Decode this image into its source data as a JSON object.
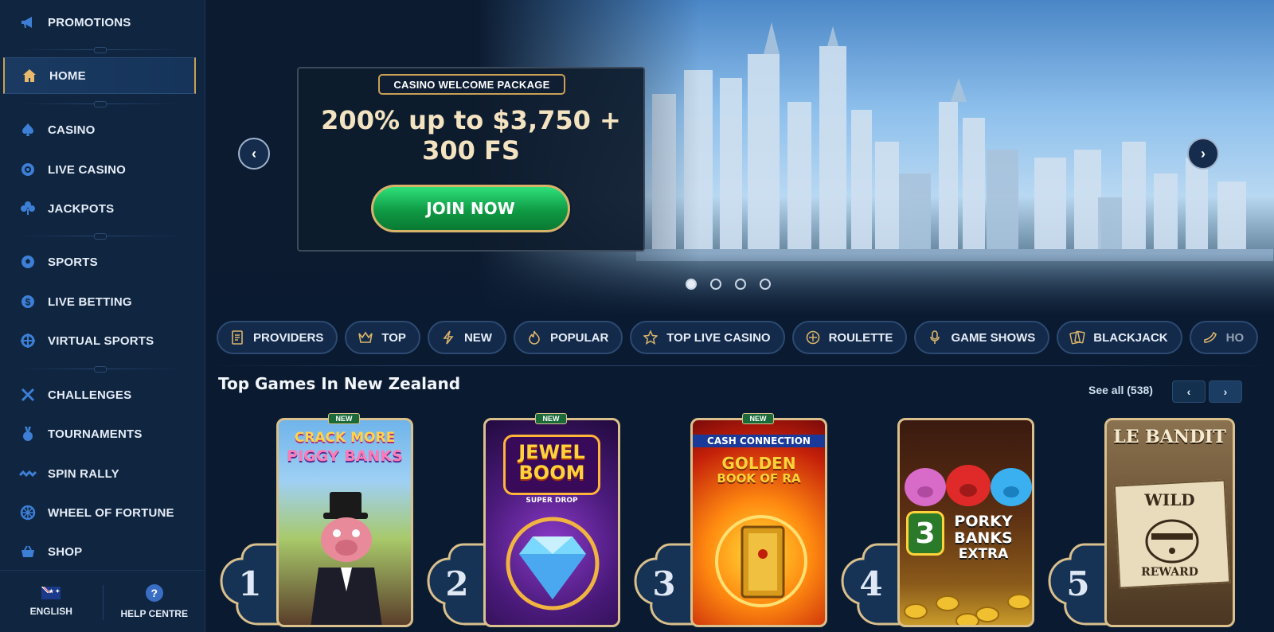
{
  "sidebar": {
    "items": [
      {
        "label": "PROMOTIONS",
        "icon": "megaphone-icon"
      },
      {
        "label": "HOME",
        "icon": "home-icon",
        "active": true
      },
      {
        "label": "CASINO",
        "icon": "spade-icon"
      },
      {
        "label": "LIVE CASINO",
        "icon": "chip-icon"
      },
      {
        "label": "JACKPOTS",
        "icon": "clover-icon"
      },
      {
        "label": "SPORTS",
        "icon": "football-icon"
      },
      {
        "label": "LIVE BETTING",
        "icon": "dollar-coin-icon"
      },
      {
        "label": "VIRTUAL SPORTS",
        "icon": "target-icon"
      },
      {
        "label": "CHALLENGES",
        "icon": "crossed-swords-icon"
      },
      {
        "label": "TOURNAMENTS",
        "icon": "medal-icon"
      },
      {
        "label": "SPIN RALLY",
        "icon": "rally-icon"
      },
      {
        "label": "WHEEL OF FORTUNE",
        "icon": "wheel-icon"
      },
      {
        "label": "SHOP",
        "icon": "basket-icon"
      }
    ],
    "footer": {
      "language": "ENGLISH",
      "help": "HELP CENTRE",
      "help_glyph": "?"
    }
  },
  "hero": {
    "badge": "CASINO WELCOME PACKAGE",
    "title_line1": "200% up to $3,750 +",
    "title_line2": "300 FS",
    "cta": "JOIN NOW",
    "prev": "‹",
    "next": "›",
    "slides": 4,
    "active_slide": 1
  },
  "categories": [
    {
      "label": "PROVIDERS",
      "icon": "book-icon"
    },
    {
      "label": "TOP",
      "icon": "crown-icon"
    },
    {
      "label": "NEW",
      "icon": "lightning-icon"
    },
    {
      "label": "POPULAR",
      "icon": "flame-icon"
    },
    {
      "label": "TOP LIVE CASINO",
      "icon": "star-icon"
    },
    {
      "label": "ROULETTE",
      "icon": "roulette-icon"
    },
    {
      "label": "GAME SHOWS",
      "icon": "microphone-icon"
    },
    {
      "label": "BLACKJACK",
      "icon": "cards-icon"
    },
    {
      "label": "HO",
      "icon": "pepper-icon"
    }
  ],
  "section": {
    "title": "Top Games In New Zealand",
    "see_all": "See all (538)",
    "prev": "‹",
    "next": "›"
  },
  "games": [
    {
      "rank": "1",
      "new": "NEW",
      "title_a": "CRACK MORE",
      "title_b": "PIGGY BANKS"
    },
    {
      "rank": "2",
      "new": "NEW",
      "title_a": "JEWEL",
      "title_b": "BOOM",
      "sub": "SUPER DROP"
    },
    {
      "rank": "3",
      "new": "NEW",
      "title_a": "CASH CONNECTION",
      "title_b": "GOLDEN",
      "title_c": "BOOK OF RA"
    },
    {
      "rank": "4",
      "title_a": "3",
      "title_b": "PORKY",
      "title_c": "BANKS",
      "title_d": "EXTRA"
    },
    {
      "rank": "5",
      "title_a": "LE BANDIT",
      "title_b": "WILD",
      "title_c": "REWARD"
    }
  ],
  "colors": {
    "accent_gold": "#c9a055",
    "cta_green": "#12a84c",
    "bg_navy": "#0a1a30",
    "sidebar": "#0f2540"
  }
}
